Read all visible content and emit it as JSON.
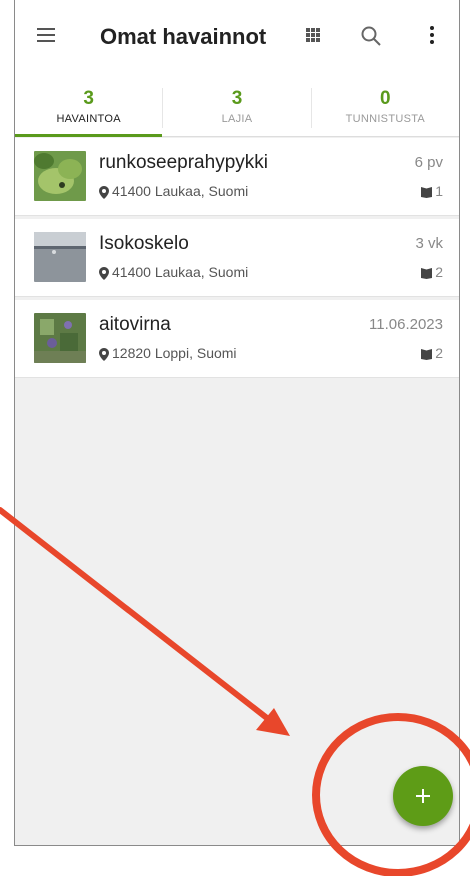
{
  "header": {
    "title": "Omat havainnot"
  },
  "tabs": [
    {
      "count": "3",
      "label": "HAVAINTOA",
      "active": true
    },
    {
      "count": "3",
      "label": "LAJIA",
      "active": false
    },
    {
      "count": "0",
      "label": "TUNNISTUSTA",
      "active": false
    }
  ],
  "observations": [
    {
      "name": "runkoseeprahypykki",
      "location": "41400 Laukaa, Suomi",
      "time": "6 pv",
      "count": "1"
    },
    {
      "name": "Isokoskelo",
      "location": "41400 Laukaa, Suomi",
      "time": "3 vk",
      "count": "2"
    },
    {
      "name": "aitovirna",
      "location": "12820 Loppi, Suomi",
      "time": "11.06.2023",
      "count": "2"
    }
  ],
  "fab": {
    "icon": "plus-icon"
  },
  "colors": {
    "accent": "#5a9a1c",
    "fab": "#5e9c17",
    "annotation": "#e8472b"
  }
}
